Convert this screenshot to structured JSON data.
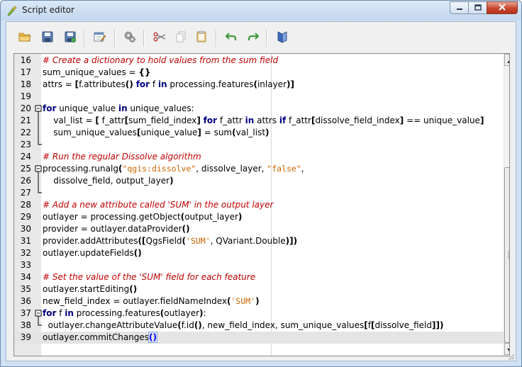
{
  "window": {
    "title": "Script editor",
    "icon": "qgis-script-icon"
  },
  "titlebar_buttons": [
    {
      "name": "minimize-button",
      "icon": "minimize-icon"
    },
    {
      "name": "maximize-button",
      "icon": "maximize-icon"
    },
    {
      "name": "close-button",
      "icon": "close-icon"
    }
  ],
  "toolbar": {
    "buttons": [
      {
        "name": "open-script-button",
        "icon": "folder-open-icon"
      },
      {
        "name": "save-script-button",
        "icon": "save-icon"
      },
      {
        "name": "save-as-button",
        "icon": "save-as-icon"
      },
      {
        "name": "edit-help-button",
        "icon": "edit-help-icon"
      },
      {
        "name": "run-algorithm-button",
        "icon": "gears-icon"
      },
      {
        "name": "cut-button",
        "icon": "scissors-icon"
      },
      {
        "name": "copy-button",
        "icon": "copy-icon"
      },
      {
        "name": "paste-button",
        "icon": "paste-icon"
      },
      {
        "name": "undo-button",
        "icon": "undo-icon"
      },
      {
        "name": "redo-button",
        "icon": "redo-icon"
      },
      {
        "name": "increase-font-button",
        "icon": "font-size-icon"
      }
    ]
  },
  "editor": {
    "current_line": 39,
    "lines": [
      {
        "n": "16",
        "fold": "none"
      },
      {
        "n": "17",
        "fold": "none"
      },
      {
        "n": "18",
        "fold": "none"
      },
      {
        "n": "19",
        "fold": "none"
      },
      {
        "n": "20",
        "fold": "open"
      },
      {
        "n": "21",
        "fold": "body"
      },
      {
        "n": "22",
        "fold": "body"
      },
      {
        "n": "23",
        "fold": "end"
      },
      {
        "n": "24",
        "fold": "none"
      },
      {
        "n": "25",
        "fold": "open"
      },
      {
        "n": "26",
        "fold": "body"
      },
      {
        "n": "27",
        "fold": "end"
      },
      {
        "n": "28",
        "fold": "none"
      },
      {
        "n": "29",
        "fold": "none"
      },
      {
        "n": "30",
        "fold": "none"
      },
      {
        "n": "31",
        "fold": "none"
      },
      {
        "n": "32",
        "fold": "none"
      },
      {
        "n": "33",
        "fold": "none"
      },
      {
        "n": "34",
        "fold": "none"
      },
      {
        "n": "35",
        "fold": "none"
      },
      {
        "n": "36",
        "fold": "none"
      },
      {
        "n": "37",
        "fold": "open"
      },
      {
        "n": "38",
        "fold": "end"
      },
      {
        "n": "39",
        "fold": "none"
      }
    ],
    "code": [
      [
        [
          "cm",
          "# Create a dictionary to hold values from the sum field"
        ]
      ],
      [
        [
          "",
          "sum_unique_values = "
        ],
        [
          "br",
          "{}"
        ]
      ],
      [
        [
          "",
          "attrs = "
        ],
        [
          "br",
          "["
        ],
        [
          "",
          "f.attributes"
        ],
        [
          "br",
          "()"
        ],
        [
          "",
          " "
        ],
        [
          "kw",
          "for"
        ],
        [
          "",
          " f "
        ],
        [
          "kw",
          "in"
        ],
        [
          "",
          " processing.features"
        ],
        [
          "br",
          "("
        ],
        [
          "",
          "inlayer"
        ],
        [
          "br",
          ")]"
        ]
      ],
      [],
      [
        [
          "kw",
          "for"
        ],
        [
          "",
          " unique_value "
        ],
        [
          "kw",
          "in"
        ],
        [
          "",
          " unique_values:"
        ]
      ],
      [
        [
          "",
          "    val_list = "
        ],
        [
          "br",
          "["
        ],
        [
          "",
          " f_attr"
        ],
        [
          "br",
          "["
        ],
        [
          "",
          "sum_field_index"
        ],
        [
          "br",
          "]"
        ],
        [
          "",
          " "
        ],
        [
          "kw",
          "for"
        ],
        [
          "",
          " f_attr "
        ],
        [
          "kw",
          "in"
        ],
        [
          "",
          " attrs "
        ],
        [
          "kw",
          "if"
        ],
        [
          "",
          " f_attr"
        ],
        [
          "br",
          "["
        ],
        [
          "",
          "dissolve_field_index"
        ],
        [
          "br",
          "]"
        ],
        [
          "",
          " == unique_value"
        ],
        [
          "br",
          "]"
        ]
      ],
      [
        [
          "",
          "    sum_unique_values"
        ],
        [
          "br",
          "["
        ],
        [
          "",
          "unique_value"
        ],
        [
          "br",
          "]"
        ],
        [
          "",
          " = sum"
        ],
        [
          "br",
          "("
        ],
        [
          "",
          "val_list"
        ],
        [
          "br",
          ")"
        ]
      ],
      [],
      [
        [
          "cm",
          "# Run the regular Dissolve algorithm"
        ]
      ],
      [
        [
          "",
          "processing.runalg"
        ],
        [
          "br",
          "("
        ],
        [
          "str",
          "\"qgis:dissolve\""
        ],
        [
          "",
          ", dissolve_layer, "
        ],
        [
          "str",
          "\"false\""
        ],
        [
          "",
          ","
        ]
      ],
      [
        [
          "",
          "    dissolve_field, output_layer"
        ],
        [
          "br",
          ")"
        ]
      ],
      [],
      [
        [
          "cm",
          "# Add a new attribute called 'SUM' in the output layer"
        ]
      ],
      [
        [
          "",
          "outlayer = processing.getObject"
        ],
        [
          "br",
          "("
        ],
        [
          "",
          "output_layer"
        ],
        [
          "br",
          ")"
        ]
      ],
      [
        [
          "",
          "provider = outlayer.dataProvider"
        ],
        [
          "br",
          "()"
        ]
      ],
      [
        [
          "",
          "provider.addAttributes"
        ],
        [
          "br",
          "(["
        ],
        [
          "",
          "QgsField"
        ],
        [
          "br",
          "("
        ],
        [
          "str",
          "'SUM'"
        ],
        [
          "",
          ", QVariant.Double"
        ],
        [
          "br",
          ")])"
        ]
      ],
      [
        [
          "",
          "outlayer.updateFields"
        ],
        [
          "br",
          "()"
        ]
      ],
      [],
      [
        [
          "cm",
          "# Set the value of the 'SUM' field for each feature"
        ]
      ],
      [
        [
          "",
          "outlayer.startEditing"
        ],
        [
          "br",
          "()"
        ]
      ],
      [
        [
          "",
          "new_field_index = outlayer.fieldNameIndex"
        ],
        [
          "br",
          "("
        ],
        [
          "str",
          "'SUM'"
        ],
        [
          "br",
          ")"
        ]
      ],
      [
        [
          "kw",
          "for"
        ],
        [
          "",
          " f "
        ],
        [
          "kw",
          "in"
        ],
        [
          "",
          " processing.features"
        ],
        [
          "br",
          "("
        ],
        [
          "",
          "outlayer"
        ],
        [
          "br",
          ")"
        ],
        [
          "",
          ":"
        ]
      ],
      [
        [
          "",
          "  outlayer.changeAttributeValue"
        ],
        [
          "br",
          "("
        ],
        [
          "",
          "f.id"
        ],
        [
          "br",
          "()"
        ],
        [
          "",
          ", new_field_index, sum_unique_values"
        ],
        [
          "br",
          "["
        ],
        [
          "",
          "f"
        ],
        [
          "br",
          "["
        ],
        [
          "",
          "dissolve_field"
        ],
        [
          "br",
          "]])"
        ]
      ],
      [
        [
          "",
          "outlayer.commitChanges"
        ],
        [
          "brm",
          "()"
        ]
      ]
    ]
  }
}
